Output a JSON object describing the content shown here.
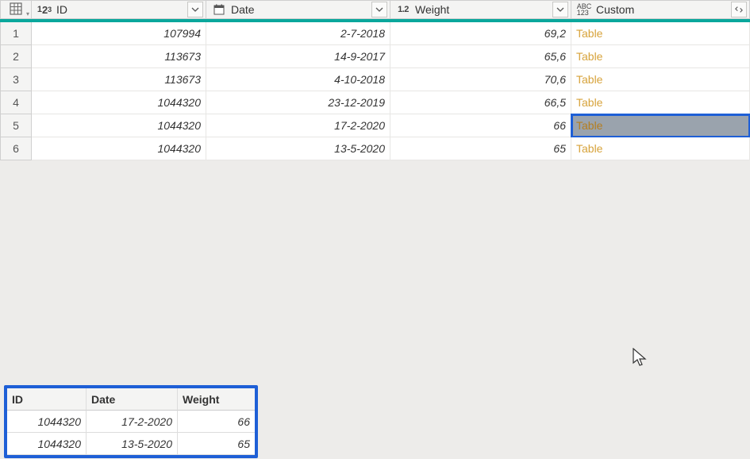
{
  "columns": {
    "id": {
      "label": "ID",
      "type_icon": "123"
    },
    "date": {
      "label": "Date",
      "type_icon": "calendar"
    },
    "weight": {
      "label": "Weight",
      "type_icon": "1.2"
    },
    "custom": {
      "label": "Custom",
      "type_icon": "ABC123"
    }
  },
  "rows": [
    {
      "n": "1",
      "id": "107994",
      "date": "2-7-2018",
      "weight": "69,2",
      "custom": "Table"
    },
    {
      "n": "2",
      "id": "113673",
      "date": "14-9-2017",
      "weight": "65,6",
      "custom": "Table"
    },
    {
      "n": "3",
      "id": "113673",
      "date": "4-10-2018",
      "weight": "70,6",
      "custom": "Table"
    },
    {
      "n": "4",
      "id": "1044320",
      "date": "23-12-2019",
      "weight": "66,5",
      "custom": "Table"
    },
    {
      "n": "5",
      "id": "1044320",
      "date": "17-2-2020",
      "weight": "66",
      "custom": "Table",
      "selected": true
    },
    {
      "n": "6",
      "id": "1044320",
      "date": "13-5-2020",
      "weight": "65",
      "custom": "Table"
    }
  ],
  "preview": {
    "headers": {
      "id": "ID",
      "date": "Date",
      "weight": "Weight"
    },
    "rows": [
      {
        "id": "1044320",
        "date": "17-2-2020",
        "weight": "66"
      },
      {
        "id": "1044320",
        "date": "13-5-2020",
        "weight": "65"
      }
    ]
  }
}
